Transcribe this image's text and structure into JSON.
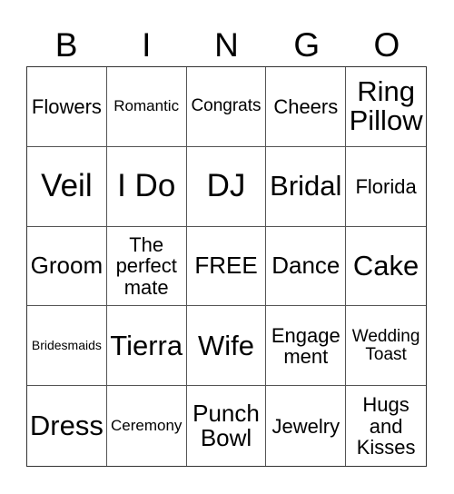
{
  "header": {
    "letters": [
      "B",
      "I",
      "N",
      "G",
      "O"
    ]
  },
  "board": {
    "rows": [
      [
        "Flowers",
        "Romantic",
        "Congrats",
        "Cheers",
        "Ring\nPillow"
      ],
      [
        "Veil",
        "I Do",
        "DJ",
        "Bridal",
        "Florida"
      ],
      [
        "Groom",
        "The\nperfect\nmate",
        "FREE",
        "Dance",
        "Cake"
      ],
      [
        "Bridesmaids",
        "Tierra",
        "Wife",
        "Engage\nment",
        "Wedding\nToast"
      ],
      [
        "Dress",
        "Ceremony",
        "Punch\nBowl",
        "Jewelry",
        "Hugs\nand\nKisses"
      ]
    ],
    "free_space": "FREE"
  },
  "colors": {
    "grid_line": "#555555",
    "text": "#000000",
    "background": "#ffffff"
  }
}
